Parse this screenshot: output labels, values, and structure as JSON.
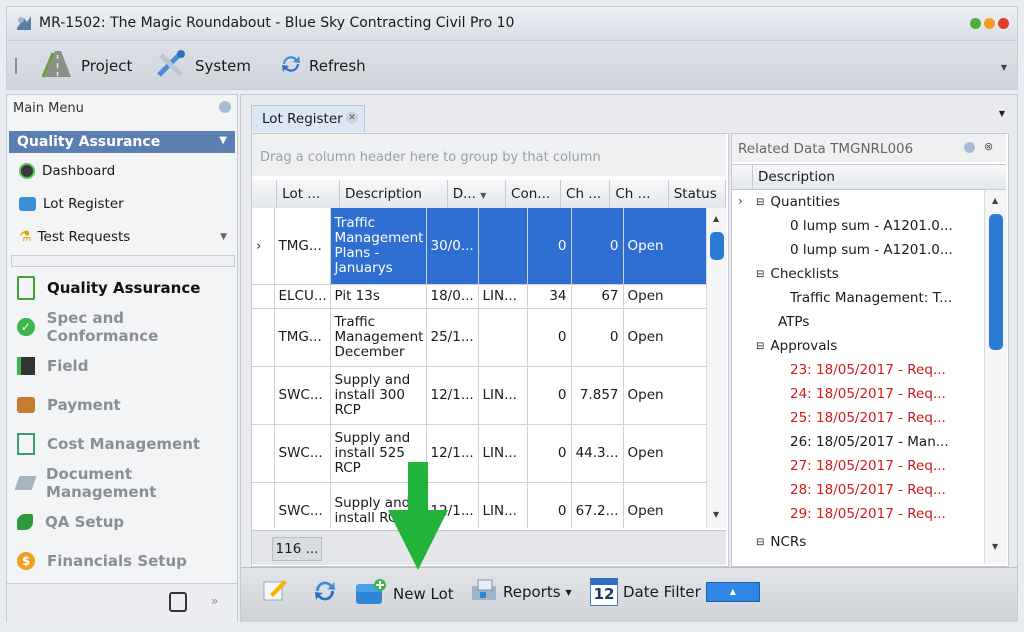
{
  "window": {
    "title": "MR-1502: The Magic Roundabout - Blue Sky Contracting Civil Pro 10"
  },
  "toolbar": {
    "project": "Project",
    "system": "System",
    "refresh": "Refresh"
  },
  "sidebar": {
    "header": "Main Menu",
    "section": "Quality Assurance",
    "items": [
      "Dashboard",
      "Lot Register",
      "Test Requests"
    ],
    "nav": [
      "Quality Assurance",
      "Spec and Conformance",
      "Field",
      "Payment",
      "Cost Management",
      "Document Management",
      "QA Setup",
      "Financials Setup"
    ]
  },
  "tab": {
    "label": "Lot Register"
  },
  "grid": {
    "group_hint": "Drag a column header here to group by that column",
    "columns": [
      "Lot ...",
      "Description",
      "D...",
      "Con...",
      "Ch ...",
      "Ch ...",
      "Status"
    ],
    "rows": [
      {
        "lot": "TMG...",
        "desc": "Traffic Management Plans - Januarys",
        "date": "30/0...",
        "con": "",
        "ch1": "0",
        "ch2": "0",
        "status": "Open"
      },
      {
        "lot": "ELCU...",
        "desc": "Pit 13s",
        "date": "18/0...",
        "con": "LIN...",
        "ch1": "34",
        "ch2": "67",
        "status": "Open"
      },
      {
        "lot": "TMG...",
        "desc": "Traffic Management December",
        "date": "25/1...",
        "con": "",
        "ch1": "0",
        "ch2": "0",
        "status": "Open"
      },
      {
        "lot": "SWC...",
        "desc": "Supply and install 300 RCP",
        "date": "12/1...",
        "con": "LIN...",
        "ch1": "0",
        "ch2": "7.857",
        "status": "Open"
      },
      {
        "lot": "SWC...",
        "desc": "Supply and install 525 RCP",
        "date": "12/1...",
        "con": "LIN...",
        "ch1": "0",
        "ch2": "44.3...",
        "status": "Open"
      },
      {
        "lot": "SWC...",
        "desc": "Supply and install RCP",
        "date": "12/1...",
        "con": "LIN...",
        "ch1": "0",
        "ch2": "67.2...",
        "status": "Open"
      }
    ],
    "footer_count": "116 ..."
  },
  "related": {
    "title": "Related Data TMGNRL006",
    "col": "Description",
    "groups": {
      "quantities": "Quantities",
      "checklists": "Checklists",
      "atps": "ATPs",
      "approvals": "Approvals",
      "ncrs": "NCRs"
    },
    "quantities": [
      "0 lump sum - A1201.0...",
      "0 lump sum - A1201.0..."
    ],
    "checklists": [
      "Traffic Management: T..."
    ],
    "approvals": [
      {
        "text": "23: 18/05/2017 - Req...",
        "red": true
      },
      {
        "text": "24: 18/05/2017 - Req...",
        "red": true
      },
      {
        "text": "25: 18/05/2017 - Req...",
        "red": true
      },
      {
        "text": "26: 18/05/2017 - Man...",
        "red": false
      },
      {
        "text": "27: 18/05/2017 - Req...",
        "red": true
      },
      {
        "text": "28: 18/05/2017 - Req...",
        "red": true
      },
      {
        "text": "29: 18/05/2017 - Req...",
        "red": true
      }
    ]
  },
  "bottom": {
    "new_lot": "New Lot",
    "reports": "Reports",
    "date_filter": "Date Filter",
    "calendar_day": "12"
  },
  "colors": {
    "selection": "#2f6fd1",
    "accent_green": "#22b33a",
    "red_text": "#d11a1a",
    "section_header": "#5b7fb3"
  }
}
